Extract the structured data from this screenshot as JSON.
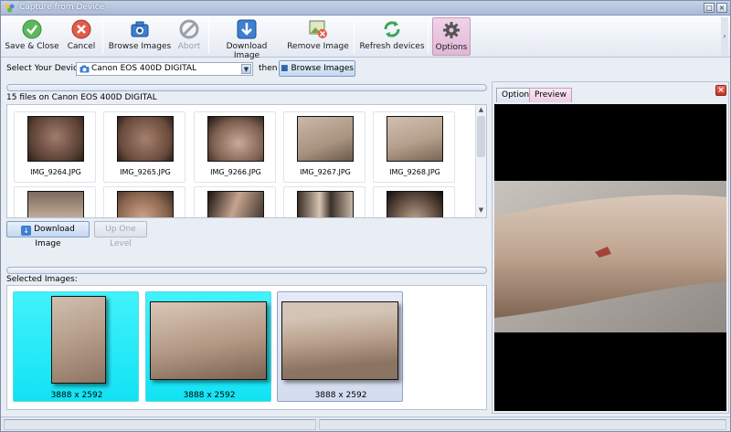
{
  "window": {
    "title": "Capture from Device"
  },
  "toolbar": {
    "save_close": "Save & Close",
    "cancel": "Cancel",
    "browse_images": "Browse Images",
    "abort": "Abort",
    "download_image": "Download Image",
    "remove_image": "Remove Image",
    "refresh_devices": "Refresh devices",
    "options": "Options"
  },
  "device": {
    "label": "Select Your Device",
    "selected": "Canon EOS 400D DIGITAL",
    "then_label": "then",
    "browse_button": "Browse Images"
  },
  "files": {
    "summary": "15 files on Canon EOS 400D DIGITAL",
    "thumbnails": [
      {
        "name": "IMG_9264.JPG"
      },
      {
        "name": "IMG_9265.JPG"
      },
      {
        "name": "IMG_9266.JPG"
      },
      {
        "name": "IMG_9267.JPG"
      },
      {
        "name": "IMG_9268.JPG"
      }
    ]
  },
  "actions": {
    "download_image": "Download Image",
    "up_one_level": "Up One Level"
  },
  "selected": {
    "label": "Selected Images:",
    "items": [
      {
        "size": "3888 x 2592"
      },
      {
        "size": "3888 x 2592"
      },
      {
        "size": "3888 x 2592"
      }
    ]
  },
  "panel": {
    "tab_options": "Options",
    "tab_preview": "Preview"
  },
  "colors": {
    "selected_highlight": "#1ce6f4",
    "active_toolbar": "#e6c2dd",
    "close_red": "#d23d2b"
  }
}
